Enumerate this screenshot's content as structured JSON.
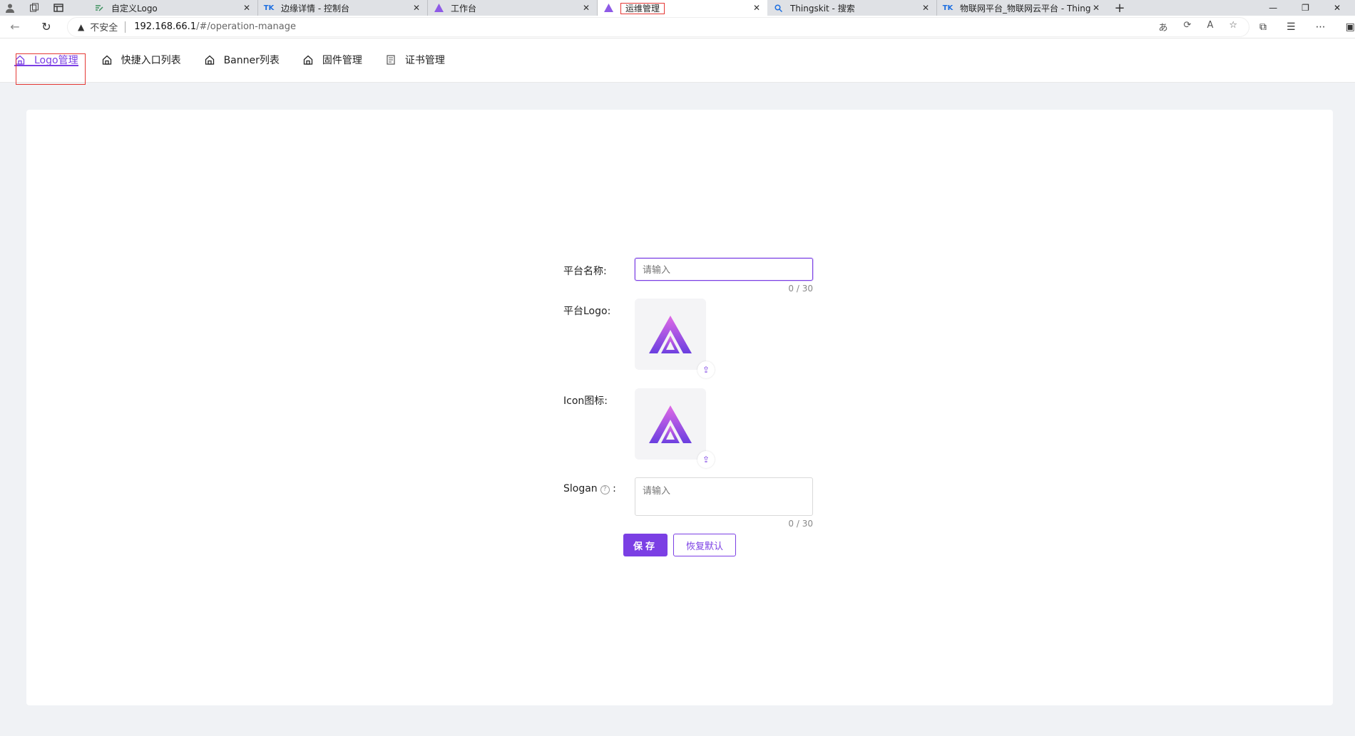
{
  "browser": {
    "tabs": [
      {
        "title": "自定义Logo",
        "favicon": "edit-icon"
      },
      {
        "title": "边缘详情 - 控制台",
        "favicon": "tk-icon"
      },
      {
        "title": "工作台",
        "favicon": "triangle-logo-icon"
      },
      {
        "title": "运维管理",
        "favicon": "triangle-logo-icon",
        "active": true
      },
      {
        "title": "Thingskit - 搜索",
        "favicon": "search-icon"
      },
      {
        "title": "物联网平台_物联网云平台 - Thingskit",
        "favicon": "tk-icon"
      }
    ],
    "security_label": "不安全",
    "url_host": "192.168.66.1",
    "url_path": "/#/operation-manage"
  },
  "menu": {
    "items": [
      {
        "label": "Logo管理",
        "icon": "home-icon",
        "active": true
      },
      {
        "label": "快捷入口列表",
        "icon": "home-icon"
      },
      {
        "label": "Banner列表",
        "icon": "home-icon"
      },
      {
        "label": "固件管理",
        "icon": "home-icon"
      },
      {
        "label": "证书管理",
        "icon": "document-icon"
      }
    ]
  },
  "form": {
    "platform_name_label": "平台名称:",
    "platform_name_placeholder": "请输入",
    "platform_name_count": "0 / 30",
    "platform_logo_label": "平台Logo:",
    "icon_label": "Icon图标:",
    "slogan_label": "Slogan",
    "slogan_colon": ":",
    "slogan_placeholder": "请输入",
    "slogan_count": "0 / 30",
    "save_button": "保存",
    "reset_button": "恢复默认"
  },
  "colors": {
    "accent": "#7b3fe4",
    "highlight_box": "#e53935"
  }
}
